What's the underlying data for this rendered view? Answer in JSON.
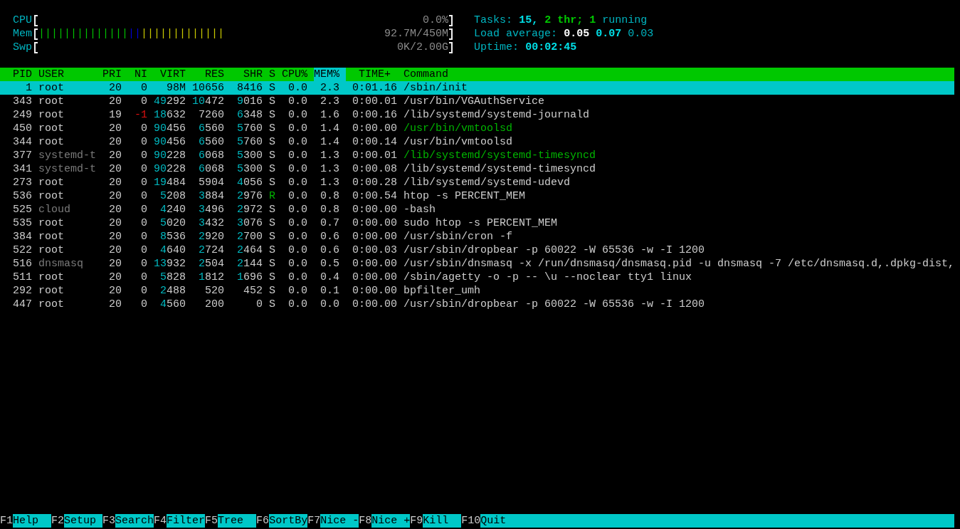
{
  "meters": [
    {
      "label": "CPU",
      "value": "0.0%"
    },
    {
      "label": "Mem",
      "value": "92.7M/450M",
      "segments": [
        {
          "bars": "||||||||||||||",
          "color": "#00c000"
        },
        {
          "bars": "||",
          "color": "#0000d0"
        },
        {
          "bars": "|||||||||||||",
          "color": "#c8c800"
        }
      ]
    },
    {
      "label": "Swp",
      "value": "0K/2.00G"
    }
  ],
  "summary": [
    {
      "parts": [
        {
          "text": "Tasks:",
          "kind": "label"
        },
        {
          "text": "15,",
          "kind": "value"
        },
        {
          "text": "2 thr;",
          "kind": "thread"
        },
        {
          "text": "1",
          "kind": "thread"
        },
        {
          "text": "running",
          "kind": "label"
        }
      ]
    },
    {
      "parts": [
        {
          "text": "Load average:",
          "kind": "label"
        },
        {
          "text": "0.05",
          "kind": "highlight"
        },
        {
          "text": "0.07",
          "kind": "value"
        },
        {
          "text": "0.03",
          "kind": "label"
        }
      ]
    },
    {
      "parts": [
        {
          "text": "Uptime:",
          "kind": "label"
        },
        {
          "text": "00:02:45",
          "kind": "value"
        }
      ]
    }
  ],
  "columns": [
    {
      "label": "PID",
      "selected": false
    },
    {
      "label": "USER",
      "selected": false
    },
    {
      "label": "PRI",
      "selected": false
    },
    {
      "label": "NI",
      "selected": false
    },
    {
      "label": "VIRT",
      "selected": false
    },
    {
      "label": "RES",
      "selected": false
    },
    {
      "label": "SHR",
      "selected": false
    },
    {
      "label": "S",
      "selected": false
    },
    {
      "label": "CPU%",
      "selected": false
    },
    {
      "label": "MEM%",
      "selected": true
    },
    {
      "label": "TIME+",
      "selected": false
    },
    {
      "label": "Command",
      "selected": false
    }
  ],
  "processes": [
    {
      "pid": "1",
      "user": "root",
      "user_dimmed": false,
      "pri": "20",
      "ni": "0",
      "ni_negative": false,
      "virt": {
        "rest": "98M"
      },
      "res": {
        "rest": "10656"
      },
      "shr": {
        "rest": "8416"
      },
      "state": "S",
      "running": false,
      "cpu": "0.0",
      "mem": "2.3",
      "time": "0:01.16",
      "command": "/sbin/init",
      "thread": false,
      "selected": true
    },
    {
      "pid": "343",
      "user": "root",
      "user_dimmed": false,
      "pri": "20",
      "ni": "0",
      "ni_negative": false,
      "virt": {
        "thousands": "49",
        "rest": "292"
      },
      "res": {
        "thousands": "10",
        "rest": "472"
      },
      "shr": {
        "thousands": "9",
        "rest": "016"
      },
      "state": "S",
      "running": false,
      "cpu": "0.0",
      "mem": "2.3",
      "time": "0:00.01",
      "command": "/usr/bin/VGAuthService",
      "thread": false,
      "selected": false
    },
    {
      "pid": "249",
      "user": "root",
      "user_dimmed": false,
      "pri": "19",
      "ni": "-1",
      "ni_negative": true,
      "virt": {
        "thousands": "18",
        "rest": "632"
      },
      "res": {
        "rest": "7260"
      },
      "shr": {
        "thousands": "6",
        "rest": "348"
      },
      "state": "S",
      "running": false,
      "cpu": "0.0",
      "mem": "1.6",
      "time": "0:00.16",
      "command": "/lib/systemd/systemd-journald",
      "thread": false,
      "selected": false
    },
    {
      "pid": "450",
      "user": "root",
      "user_dimmed": false,
      "pri": "20",
      "ni": "0",
      "ni_negative": false,
      "virt": {
        "thousands": "90",
        "rest": "456"
      },
      "res": {
        "thousands": "6",
        "rest": "560"
      },
      "shr": {
        "thousands": "5",
        "rest": "760"
      },
      "state": "S",
      "running": false,
      "cpu": "0.0",
      "mem": "1.4",
      "time": "0:00.00",
      "command": "/usr/bin/vmtoolsd",
      "thread": true,
      "selected": false
    },
    {
      "pid": "344",
      "user": "root",
      "user_dimmed": false,
      "pri": "20",
      "ni": "0",
      "ni_negative": false,
      "virt": {
        "thousands": "90",
        "rest": "456"
      },
      "res": {
        "thousands": "6",
        "rest": "560"
      },
      "shr": {
        "thousands": "5",
        "rest": "760"
      },
      "state": "S",
      "running": false,
      "cpu": "0.0",
      "mem": "1.4",
      "time": "0:00.14",
      "command": "/usr/bin/vmtoolsd",
      "thread": false,
      "selected": false
    },
    {
      "pid": "377",
      "user": "systemd-t",
      "user_dimmed": true,
      "pri": "20",
      "ni": "0",
      "ni_negative": false,
      "virt": {
        "thousands": "90",
        "rest": "228"
      },
      "res": {
        "thousands": "6",
        "rest": "068"
      },
      "shr": {
        "thousands": "5",
        "rest": "300"
      },
      "state": "S",
      "running": false,
      "cpu": "0.0",
      "mem": "1.3",
      "time": "0:00.01",
      "command": "/lib/systemd/systemd-timesyncd",
      "thread": true,
      "selected": false
    },
    {
      "pid": "341",
      "user": "systemd-t",
      "user_dimmed": true,
      "pri": "20",
      "ni": "0",
      "ni_negative": false,
      "virt": {
        "thousands": "90",
        "rest": "228"
      },
      "res": {
        "thousands": "6",
        "rest": "068"
      },
      "shr": {
        "thousands": "5",
        "rest": "300"
      },
      "state": "S",
      "running": false,
      "cpu": "0.0",
      "mem": "1.3",
      "time": "0:00.08",
      "command": "/lib/systemd/systemd-timesyncd",
      "thread": false,
      "selected": false
    },
    {
      "pid": "273",
      "user": "root",
      "user_dimmed": false,
      "pri": "20",
      "ni": "0",
      "ni_negative": false,
      "virt": {
        "thousands": "19",
        "rest": "484"
      },
      "res": {
        "rest": "5904"
      },
      "shr": {
        "thousands": "4",
        "rest": "056"
      },
      "state": "S",
      "running": false,
      "cpu": "0.0",
      "mem": "1.3",
      "time": "0:00.28",
      "command": "/lib/systemd/systemd-udevd",
      "thread": false,
      "selected": false
    },
    {
      "pid": "536",
      "user": "root",
      "user_dimmed": false,
      "pri": "20",
      "ni": "0",
      "ni_negative": false,
      "virt": {
        "thousands": "5",
        "rest": "208"
      },
      "res": {
        "thousands": "3",
        "rest": "884"
      },
      "shr": {
        "thousands": "2",
        "rest": "976"
      },
      "state": "R",
      "running": true,
      "cpu": "0.0",
      "mem": "0.8",
      "time": "0:00.54",
      "command": "htop -s PERCENT_MEM",
      "thread": false,
      "selected": false
    },
    {
      "pid": "525",
      "user": "cloud",
      "user_dimmed": true,
      "pri": "20",
      "ni": "0",
      "ni_negative": false,
      "virt": {
        "thousands": "4",
        "rest": "240"
      },
      "res": {
        "thousands": "3",
        "rest": "496"
      },
      "shr": {
        "thousands": "2",
        "rest": "972"
      },
      "state": "S",
      "running": false,
      "cpu": "0.0",
      "mem": "0.8",
      "time": "0:00.00",
      "command": "-bash",
      "thread": false,
      "selected": false
    },
    {
      "pid": "535",
      "user": "root",
      "user_dimmed": false,
      "pri": "20",
      "ni": "0",
      "ni_negative": false,
      "virt": {
        "thousands": "5",
        "rest": "020"
      },
      "res": {
        "thousands": "3",
        "rest": "432"
      },
      "shr": {
        "thousands": "3",
        "rest": "076"
      },
      "state": "S",
      "running": false,
      "cpu": "0.0",
      "mem": "0.7",
      "time": "0:00.00",
      "command": "sudo htop -s PERCENT_MEM",
      "thread": false,
      "selected": false
    },
    {
      "pid": "384",
      "user": "root",
      "user_dimmed": false,
      "pri": "20",
      "ni": "0",
      "ni_negative": false,
      "virt": {
        "thousands": "8",
        "rest": "536"
      },
      "res": {
        "thousands": "2",
        "rest": "920"
      },
      "shr": {
        "thousands": "2",
        "rest": "700"
      },
      "state": "S",
      "running": false,
      "cpu": "0.0",
      "mem": "0.6",
      "time": "0:00.00",
      "command": "/usr/sbin/cron -f",
      "thread": false,
      "selected": false
    },
    {
      "pid": "522",
      "user": "root",
      "user_dimmed": false,
      "pri": "20",
      "ni": "0",
      "ni_negative": false,
      "virt": {
        "thousands": "4",
        "rest": "640"
      },
      "res": {
        "thousands": "2",
        "rest": "724"
      },
      "shr": {
        "thousands": "2",
        "rest": "464"
      },
      "state": "S",
      "running": false,
      "cpu": "0.0",
      "mem": "0.6",
      "time": "0:00.03",
      "command": "/usr/sbin/dropbear -p 60022 -W 65536 -w -I 1200",
      "thread": false,
      "selected": false
    },
    {
      "pid": "516",
      "user": "dnsmasq",
      "user_dimmed": true,
      "pri": "20",
      "ni": "0",
      "ni_negative": false,
      "virt": {
        "thousands": "13",
        "rest": "932"
      },
      "res": {
        "thousands": "2",
        "rest": "504"
      },
      "shr": {
        "thousands": "2",
        "rest": "144"
      },
      "state": "S",
      "running": false,
      "cpu": "0.0",
      "mem": "0.5",
      "time": "0:00.00",
      "command": "/usr/sbin/dnsmasq -x /run/dnsmasq/dnsmasq.pid -u dnsmasq -7 /etc/dnsmasq.d,.dpkg-dist,",
      "thread": false,
      "selected": false
    },
    {
      "pid": "511",
      "user": "root",
      "user_dimmed": false,
      "pri": "20",
      "ni": "0",
      "ni_negative": false,
      "virt": {
        "thousands": "5",
        "rest": "828"
      },
      "res": {
        "thousands": "1",
        "rest": "812"
      },
      "shr": {
        "thousands": "1",
        "rest": "696"
      },
      "state": "S",
      "running": false,
      "cpu": "0.0",
      "mem": "0.4",
      "time": "0:00.00",
      "command": "/sbin/agetty -o -p -- \\u --noclear tty1 linux",
      "thread": false,
      "selected": false
    },
    {
      "pid": "292",
      "user": "root",
      "user_dimmed": false,
      "pri": "20",
      "ni": "0",
      "ni_negative": false,
      "virt": {
        "thousands": "2",
        "rest": "488"
      },
      "res": {
        "rest": "520"
      },
      "shr": {
        "rest": "452"
      },
      "state": "S",
      "running": false,
      "cpu": "0.0",
      "mem": "0.1",
      "time": "0:00.00",
      "command": "bpfilter_umh",
      "thread": false,
      "selected": false
    },
    {
      "pid": "447",
      "user": "root",
      "user_dimmed": false,
      "pri": "20",
      "ni": "0",
      "ni_negative": false,
      "virt": {
        "thousands": "4",
        "rest": "560"
      },
      "res": {
        "rest": "200"
      },
      "shr": {
        "rest": "0"
      },
      "state": "S",
      "running": false,
      "cpu": "0.0",
      "mem": "0.0",
      "time": "0:00.00",
      "command": "/usr/sbin/dropbear -p 60022 -W 65536 -w -I 1200",
      "thread": false,
      "selected": false
    }
  ],
  "function_keys": [
    {
      "key": "F1",
      "label": "Help"
    },
    {
      "key": "F2",
      "label": "Setup"
    },
    {
      "key": "F3",
      "label": "Search"
    },
    {
      "key": "F4",
      "label": "Filter"
    },
    {
      "key": "F5",
      "label": "Tree"
    },
    {
      "key": "F6",
      "label": "SortBy"
    },
    {
      "key": "F7",
      "label": "Nice -"
    },
    {
      "key": "F8",
      "label": "Nice +"
    },
    {
      "key": "F9",
      "label": "Kill"
    },
    {
      "key": "F10",
      "label": "Quit"
    }
  ]
}
